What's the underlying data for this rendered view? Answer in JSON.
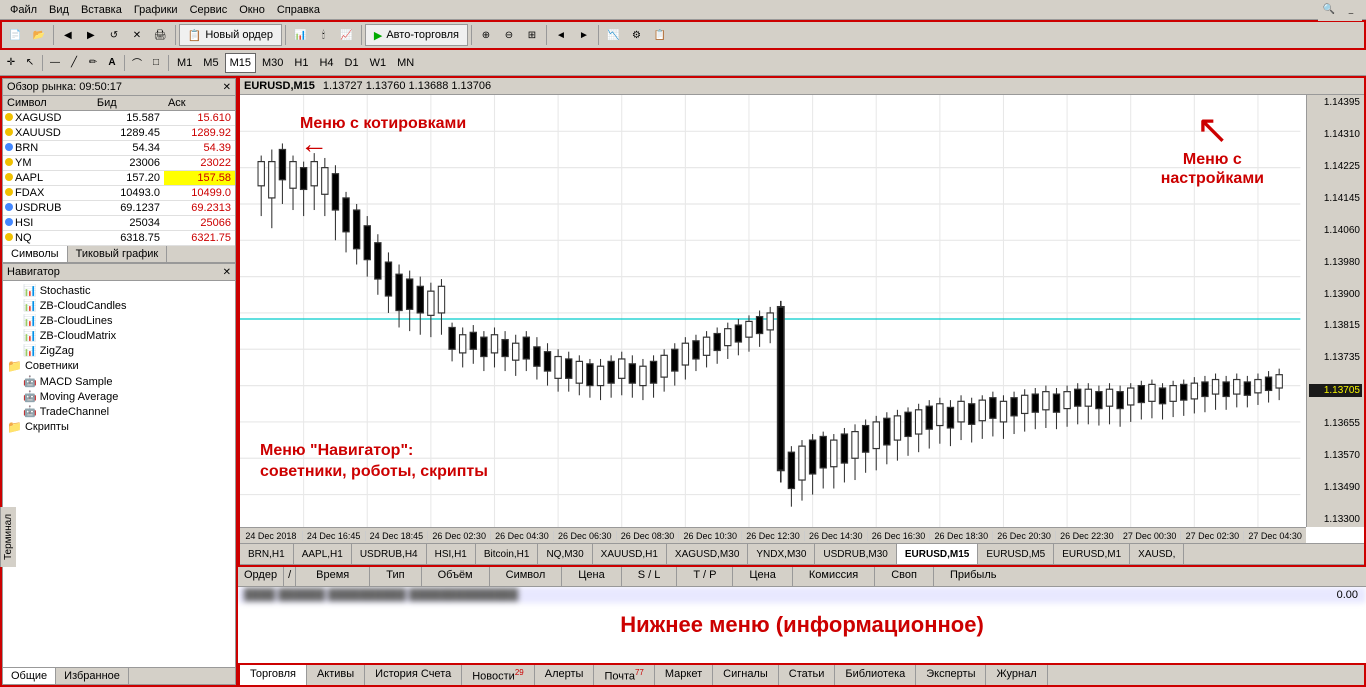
{
  "menubar": {
    "items": [
      "Файл",
      "Вид",
      "Вставка",
      "Графики",
      "Сервис",
      "Окно",
      "Справка"
    ]
  },
  "toolbar": {
    "new_order_label": "Новый ордер",
    "auto_trade_label": "Авто-торговля",
    "timeframes": [
      "M1",
      "M5",
      "M15",
      "M30",
      "H1",
      "H4",
      "D1",
      "W1",
      "MN"
    ]
  },
  "market_watch": {
    "title": "Обзор рынка: 09:50:17",
    "columns": [
      "Символ",
      "Бид",
      "Аск"
    ],
    "rows": [
      {
        "symbol": "XAGUSD",
        "bid": "15.587",
        "ask": "15.610",
        "dot": "yellow"
      },
      {
        "symbol": "XAUUSD",
        "bid": "1289.45",
        "ask": "1289.92",
        "dot": "yellow"
      },
      {
        "symbol": "BRN",
        "bid": "54.34",
        "ask": "54.39",
        "dot": "blue"
      },
      {
        "symbol": "YM",
        "bid": "23006",
        "ask": "23022",
        "dot": "yellow"
      },
      {
        "symbol": "AAPL",
        "bid": "157.20",
        "ask": "157.58",
        "dot": "yellow"
      },
      {
        "symbol": "FDAX",
        "bid": "10493.0",
        "ask": "10499.0",
        "dot": "yellow"
      },
      {
        "symbol": "USDRUB",
        "bid": "69.1237",
        "ask": "69.2313",
        "dot": "blue"
      },
      {
        "symbol": "HSI",
        "bid": "25034",
        "ask": "25066",
        "dot": "blue"
      },
      {
        "symbol": "NQ",
        "bid": "6318.75",
        "ask": "6321.75",
        "dot": "yellow"
      }
    ],
    "tabs": [
      "Символы",
      "Тиковый график"
    ]
  },
  "navigator": {
    "title": "Навигатор",
    "tree": [
      {
        "label": "Stochastic",
        "type": "indicator",
        "indent": 2
      },
      {
        "label": "ZB-CloudCandles",
        "type": "indicator",
        "indent": 2
      },
      {
        "label": "ZB-CloudLines",
        "type": "indicator",
        "indent": 2
      },
      {
        "label": "ZB-CloudMatrix",
        "type": "indicator",
        "indent": 2
      },
      {
        "label": "ZigZag",
        "type": "indicator",
        "indent": 2
      },
      {
        "label": "Советники",
        "type": "folder",
        "indent": 0
      },
      {
        "label": "MACD Sample",
        "type": "advisor",
        "indent": 2
      },
      {
        "label": "Moving Average",
        "type": "advisor",
        "indent": 2
      },
      {
        "label": "TradeChannel",
        "type": "advisor",
        "indent": 2
      },
      {
        "label": "Скрипты",
        "type": "folder",
        "indent": 0
      }
    ],
    "tabs": [
      "Общие",
      "Избранное"
    ]
  },
  "chart": {
    "symbol": "EURUSD,M15",
    "prices": "1.13727 1.13760 1.13688 1.13706",
    "price_scale": [
      "1.14395",
      "1.14310",
      "1.14225",
      "1.14145",
      "1.14060",
      "1.13980",
      "1.13900",
      "1.13815",
      "1.13735",
      "1.13705",
      "1.13655",
      "1.13570",
      "1.13490",
      "1.13300"
    ],
    "current_price": "1.13705",
    "time_labels": [
      "24 Dec 2018",
      "24 Dec 16:45",
      "24 Dec 18:45",
      "26 Dec 02:30",
      "26 Dec 04:30",
      "26 Dec 06:30",
      "26 Dec 08:30",
      "26 Dec 10:30",
      "26 Dec 12:30",
      "26 Dec 14:30",
      "26 Dec 16:30",
      "26 Dec 18:30",
      "26 Dec 20:30",
      "26 Dec 22:30",
      "27 Dec 00:30",
      "27 Dec 02:30",
      "27 Dec 04:30"
    ]
  },
  "chart_tabs": [
    "BRN,H1",
    "AAPL,H1",
    "USDRUB,H4",
    "HSI,H1",
    "Bitcoin,H1",
    "NQ,M30",
    "XAUUSD,H1",
    "XAGUSD,M30",
    "YNDX,M30",
    "USDRUB,M30",
    "EURUSD,M15",
    "EURUSD,M5",
    "EURUSD,M1",
    "XAUSD,"
  ],
  "terminal": {
    "columns": [
      "Ордер",
      "/",
      "Время",
      "Тип",
      "Объём",
      "Символ",
      "Цена",
      "S / L",
      "T / P",
      "Цена",
      "Комиссия",
      "Своп",
      "Прибыль"
    ],
    "profit": "0.00",
    "tabs": [
      "Торговля",
      "Активы",
      "История Счета",
      "Новости",
      "Алерты",
      "Почта",
      "Маркет",
      "Сигналы",
      "Статьи",
      "Библиотека",
      "Эксперты",
      "Журнал"
    ],
    "news_count": "29",
    "mail_count": "77"
  },
  "annotations": {
    "menu_quotes": "Меню с котировками",
    "menu_settings": "Меню с\nнастройками",
    "menu_navigator": "Меню \"Навигатор\":\nсоветники, роботы, скрипты",
    "bottom_menu": "Нижнее меню (информационное)"
  }
}
